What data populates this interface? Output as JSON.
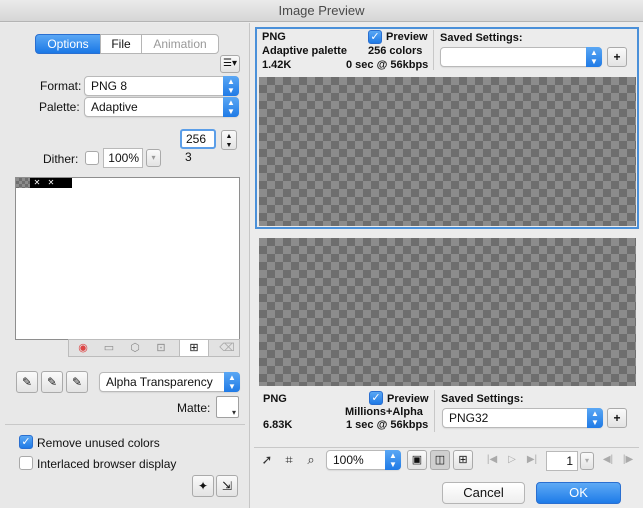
{
  "window": {
    "title": "Image Preview"
  },
  "left": {
    "tabs": [
      {
        "label": "Options",
        "active": true
      },
      {
        "label": "File",
        "active": false
      },
      {
        "label": "Animation",
        "active": false
      }
    ],
    "format": {
      "label": "Format:",
      "value": "PNG 8"
    },
    "palette": {
      "label": "Palette:",
      "value": "Adaptive"
    },
    "colors": {
      "count": "256",
      "sub": "3"
    },
    "dither": {
      "label": "Dither:",
      "value": "100%"
    },
    "transparency": {
      "value": "Alpha Transparency"
    },
    "matte": {
      "label": "Matte:"
    },
    "options": [
      {
        "label": "Remove unused colors",
        "checked": true
      },
      {
        "label": "Interlaced browser display",
        "checked": false
      }
    ]
  },
  "preview_top": {
    "format": "PNG",
    "palette": "Adaptive palette",
    "size": "1.42K",
    "preview_label": "Preview",
    "colors": "256 colors",
    "time": "0 sec @ 56kbps",
    "saved_label": "Saved Settings:",
    "saved_value": ""
  },
  "preview_bottom": {
    "format": "PNG",
    "size": "6.83K",
    "preview_label": "Preview",
    "colors": "Millions+Alpha",
    "time": "1 sec @ 56kbps",
    "saved_label": "Saved Settings:",
    "saved_value": "PNG32"
  },
  "toolbar": {
    "zoom": "100%",
    "frame": "1"
  },
  "buttons": {
    "cancel": "Cancel",
    "ok": "OK"
  },
  "colors": {
    "accent": "#1f7ae6",
    "selection_border": "#4a90d9",
    "checker_dark": "#6e6e6e",
    "checker_light": "#8c8c8c"
  }
}
